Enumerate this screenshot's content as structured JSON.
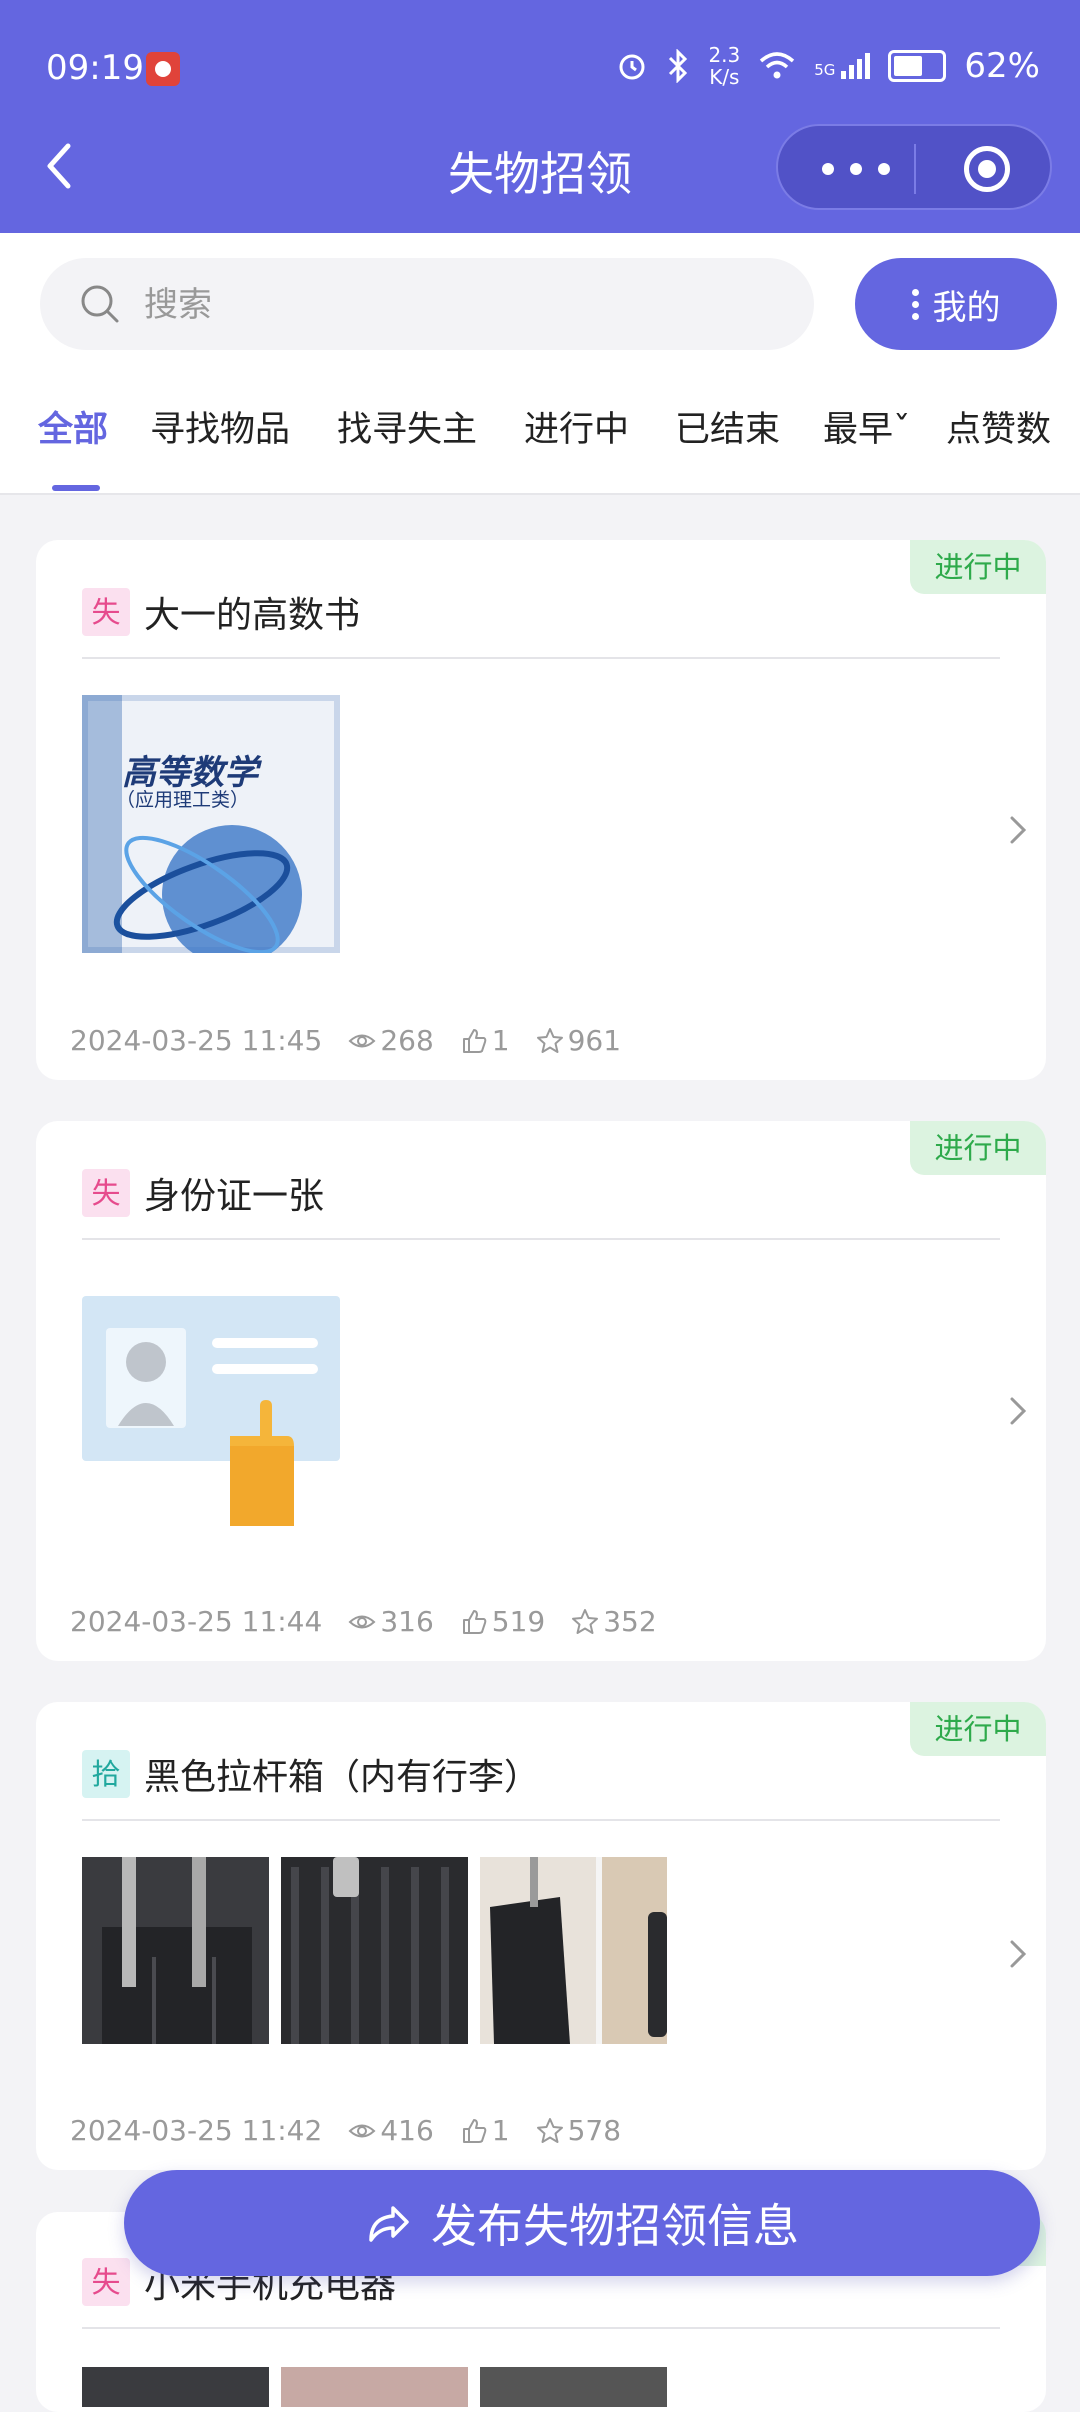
{
  "status_bar": {
    "time": "09:19",
    "net_speed_value": "2.3",
    "net_speed_unit": "K/s",
    "signal_label": "5G",
    "battery": "62%"
  },
  "header": {
    "title": "失物招领"
  },
  "search": {
    "placeholder": "搜索",
    "mine_label": "我的"
  },
  "tabs": [
    {
      "label": "全部",
      "active": true
    },
    {
      "label": "寻找物品"
    },
    {
      "label": "找寻失主"
    },
    {
      "label": "进行中"
    },
    {
      "label": "已结束"
    },
    {
      "label": "最早ˇ"
    },
    {
      "label": "点赞数"
    }
  ],
  "posts": [
    {
      "status": "进行中",
      "type": "失",
      "title": "大一的高数书",
      "book_title": "高等数学",
      "book_subtitle": "（应用理工类）",
      "date": "2024-03-25 11:45",
      "views": "268",
      "likes": "1",
      "stars": "961"
    },
    {
      "status": "进行中",
      "type": "失",
      "title": "身份证一张",
      "date": "2024-03-25 11:44",
      "views": "316",
      "likes": "519",
      "stars": "352"
    },
    {
      "status": "进行中",
      "type": "拾",
      "title": "黑色拉杆箱（内有行李）",
      "date": "2024-03-25 11:42",
      "views": "416",
      "likes": "1",
      "stars": "578"
    },
    {
      "type": "失",
      "title": "小米手机充电器"
    }
  ],
  "publish_label": "发布失物招领信息",
  "colors": {
    "primary": "#6466e0",
    "status_green": "#2eaa4b",
    "lost_pink": "#e64b8d",
    "found_teal": "#21a89e"
  }
}
